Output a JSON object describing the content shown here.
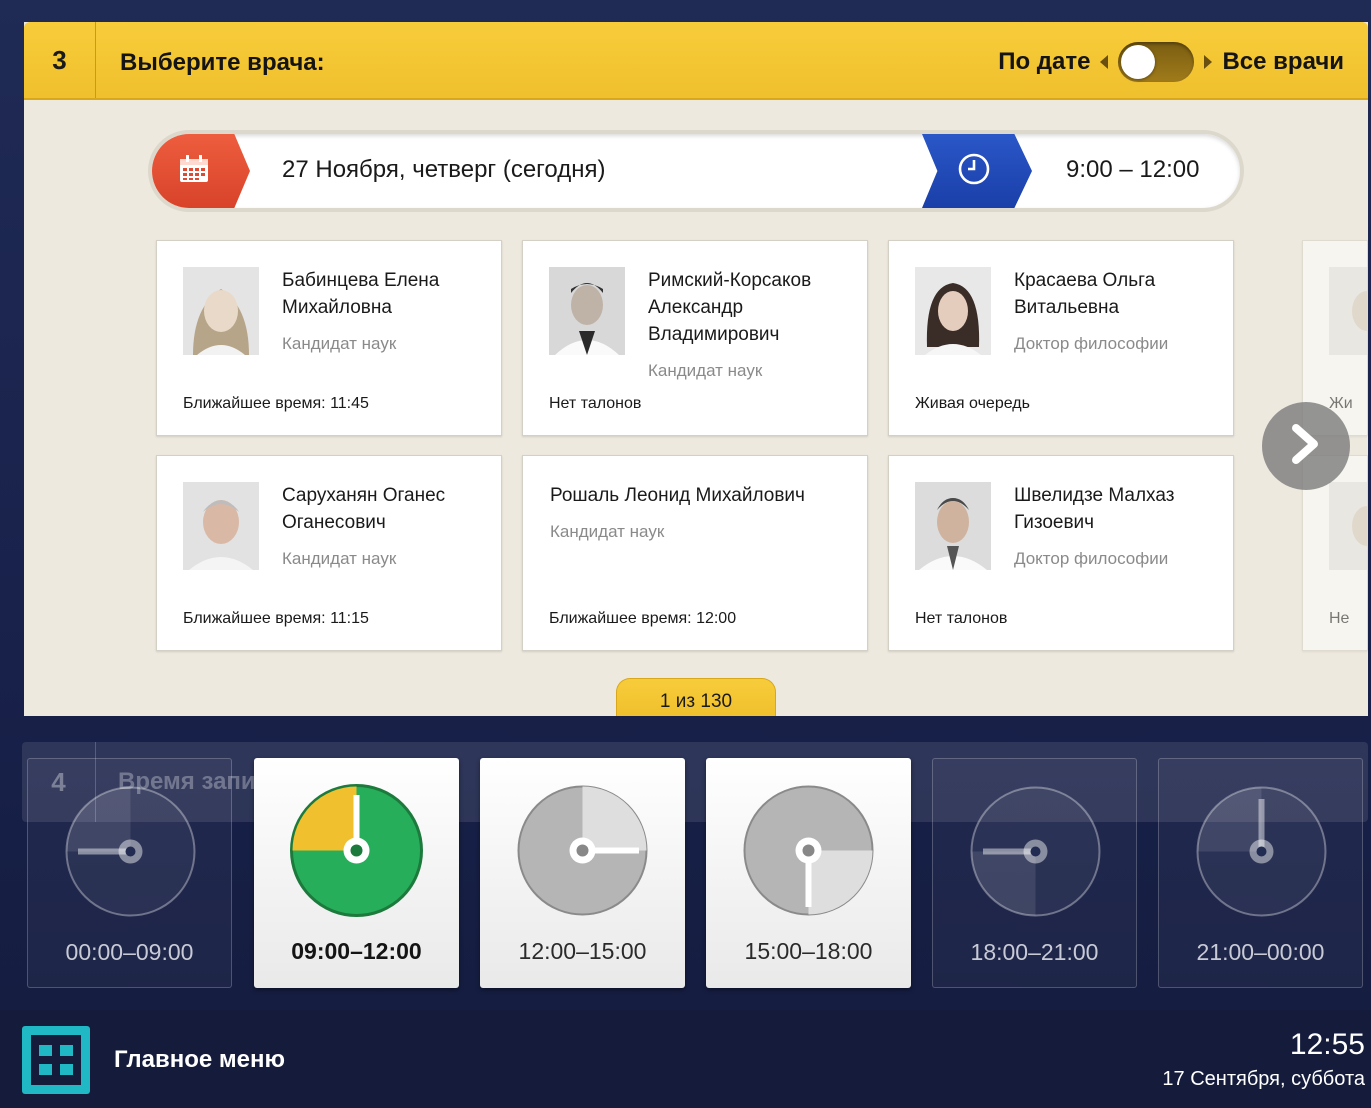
{
  "step": {
    "number": "3",
    "title": "Выберите врача:"
  },
  "step_next": {
    "number": "4",
    "title": "Время записи"
  },
  "view_toggle": {
    "left_label": "По дате",
    "right_label": "Все врачи",
    "state": "left"
  },
  "filter": {
    "date": "27 Ноября, четверг (сегодня)",
    "time": "9:00 – 12:00"
  },
  "doctors": [
    {
      "name": "Бабинцева Елена Михайловна",
      "degree": "Кандидат наук",
      "status": "Ближайшее время: 11:45"
    },
    {
      "name": "Римский-Корсаков Александр Владимирович",
      "degree": "Кандидат наук",
      "status": "Нет талонов"
    },
    {
      "name": "Красаева Ольга Витальевна",
      "degree": "Доктор философии",
      "status": "Живая очередь"
    },
    {
      "name": "Саруханян Оганес Оганесович",
      "degree": "Кандидат наук",
      "status": "Ближайшее время: 11:15"
    },
    {
      "name": "Рошаль Леонид Михайлович",
      "degree": "Кандидат наук",
      "status": "Ближайшее время: 12:00"
    },
    {
      "name": "Швелидзе Малхаз Гизоевич",
      "degree": "Доктор философии",
      "status": "Нет талонов"
    }
  ],
  "partial_cards": [
    {
      "status_fragment": "Жи"
    },
    {
      "status_fragment": "Не"
    }
  ],
  "pagination": {
    "label": "1 из 130"
  },
  "time_slots": [
    {
      "label": "00:00–09:00",
      "state": "disabled"
    },
    {
      "label": "09:00–12:00",
      "state": "selected"
    },
    {
      "label": "12:00–15:00",
      "state": "available"
    },
    {
      "label": "15:00–18:00",
      "state": "available"
    },
    {
      "label": "18:00–21:00",
      "state": "disabled"
    },
    {
      "label": "21:00–00:00",
      "state": "disabled"
    }
  ],
  "footer": {
    "menu_label": "Главное меню",
    "time": "12:55",
    "date": "17 Сентября, суббота"
  },
  "colors": {
    "accent_yellow": "#f0c02e",
    "calendar_red": "#e04a30",
    "time_blue": "#1f4ab8",
    "slot_green": "#27ae5a",
    "menu_teal": "#1fb8c4"
  },
  "icons": {
    "calendar": "calendar-icon",
    "clock": "clock-icon",
    "next": "chevron-right-icon",
    "menu": "grid-menu-icon"
  }
}
